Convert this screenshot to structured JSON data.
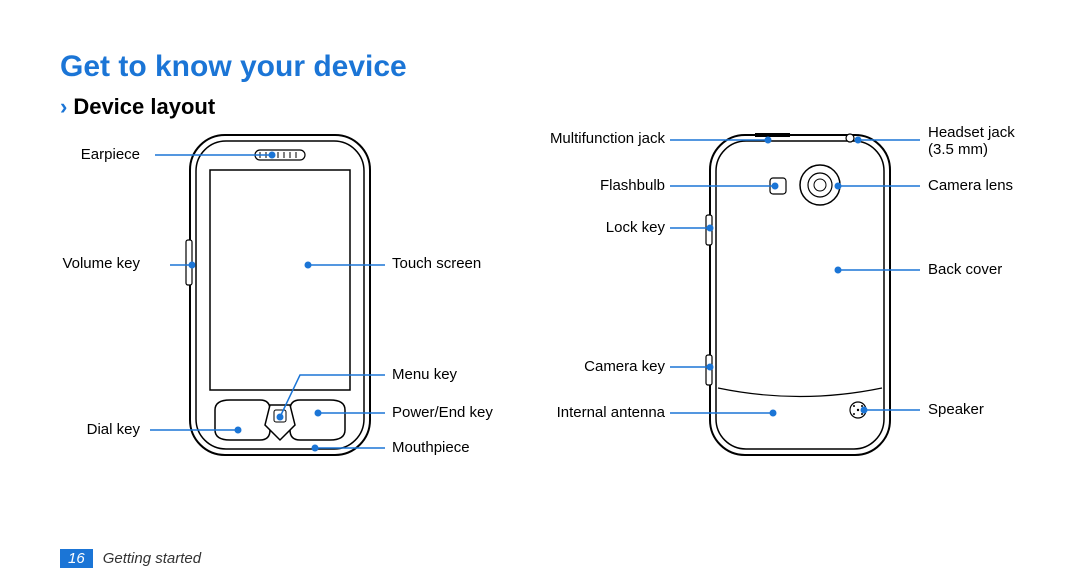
{
  "title": "Get to know your device",
  "section_title": "Device layout",
  "front": {
    "earpiece": "Earpiece",
    "volume_key": "Volume key",
    "dial_key": "Dial key",
    "touch_screen": "Touch screen",
    "menu_key": "Menu key",
    "power_end_key": "Power/End key",
    "mouthpiece": "Mouthpiece"
  },
  "back": {
    "multifunction_jack": "Multifunction jack",
    "flashbulb": "Flashbulb",
    "lock_key": "Lock key",
    "camera_key": "Camera key",
    "internal_antenna": "Internal antenna",
    "headset_jack_line1": "Headset jack",
    "headset_jack_line2": "(3.5 mm)",
    "camera_lens": "Camera lens",
    "back_cover": "Back cover",
    "speaker": "Speaker"
  },
  "footer": {
    "page_number": "16",
    "chapter": "Getting started"
  }
}
